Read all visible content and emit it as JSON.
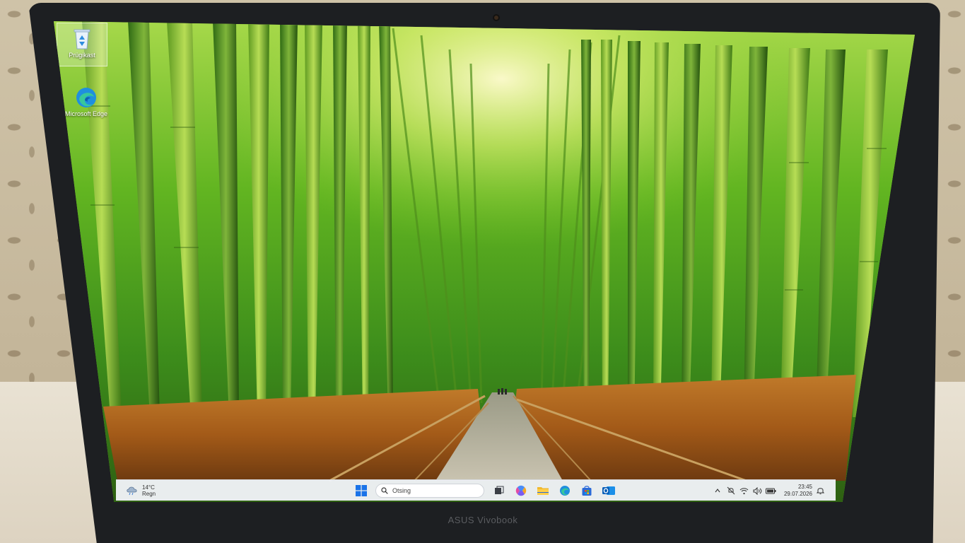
{
  "laptop": {
    "brand": "ASUS Vivobook"
  },
  "desktop": {
    "icons": [
      {
        "label": "Prügikast",
        "icon": "recycle-bin-icon"
      },
      {
        "label": "Microsoft Edge",
        "icon": "edge-icon"
      }
    ]
  },
  "taskbar": {
    "weather": {
      "temp": "14°C",
      "condition": "Regn",
      "icon": "cloud-rain-icon"
    },
    "search_placeholder": "Otsing",
    "apps": [
      {
        "name": "start",
        "icon": "windows-start-icon"
      },
      {
        "name": "task-view",
        "icon": "task-view-icon"
      },
      {
        "name": "copilot",
        "icon": "copilot-icon"
      },
      {
        "name": "file-explorer",
        "icon": "folder-icon"
      },
      {
        "name": "edge",
        "icon": "edge-icon"
      },
      {
        "name": "store",
        "icon": "store-icon"
      },
      {
        "name": "outlook",
        "icon": "outlook-icon"
      }
    ],
    "tray": {
      "icons": [
        "chevron-up-icon",
        "notifications-off-icon",
        "wifi-icon",
        "speaker-icon",
        "battery-icon"
      ],
      "time": "23:45",
      "date": "29.07.2026"
    }
  },
  "colors": {
    "accent": "#0a64d8",
    "taskbar": "#f0f2f6",
    "bezel": "#1d1f22"
  }
}
